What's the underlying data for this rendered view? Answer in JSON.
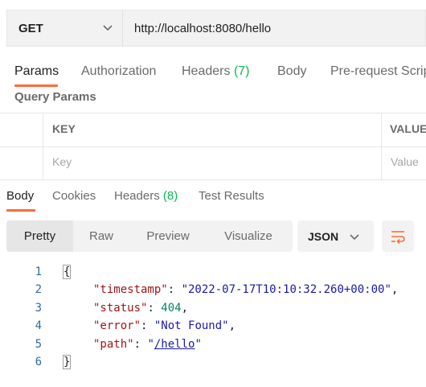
{
  "request": {
    "method": "GET",
    "url": "http://localhost:8080/hello"
  },
  "request_tabs": [
    {
      "label": "Params",
      "count": ""
    },
    {
      "label": "Authorization",
      "count": ""
    },
    {
      "label": "Headers",
      "count": "(7)"
    },
    {
      "label": "Body",
      "count": ""
    },
    {
      "label": "Pre-request Script",
      "count": ""
    }
  ],
  "query_params": {
    "title": "Query Params",
    "columns": [
      "KEY",
      "VALUE"
    ],
    "placeholder_row": [
      "Key",
      "Value"
    ]
  },
  "response_tabs": [
    {
      "label": "Body",
      "count": ""
    },
    {
      "label": "Cookies",
      "count": ""
    },
    {
      "label": "Headers",
      "count": "(8)"
    },
    {
      "label": "Test Results",
      "count": ""
    }
  ],
  "view_modes": [
    "Pretty",
    "Raw",
    "Preview",
    "Visualize"
  ],
  "format": "JSON",
  "response_body": {
    "line_numbers": [
      "1",
      "2",
      "3",
      "4",
      "5",
      "6"
    ],
    "open_brace": "{",
    "close_brace": "}",
    "fields": [
      {
        "key": "\"timestamp\"",
        "sep": ": ",
        "value": "\"2022-07-17T10:10:32.260+00:00\"",
        "trail": ","
      },
      {
        "key": "\"status\"",
        "sep": ": ",
        "value": "404",
        "trail": ","
      },
      {
        "key": "\"error\"",
        "sep": ": ",
        "value": "\"Not Found\"",
        "trail": ","
      },
      {
        "key": "\"path\"",
        "sep": ": ",
        "value_q1": "\"",
        "value_link": "/hello",
        "value_q2": "\"",
        "trail": ""
      }
    ]
  },
  "colors": {
    "accent": "#ff6c37",
    "count_green": "#0cbb52"
  }
}
